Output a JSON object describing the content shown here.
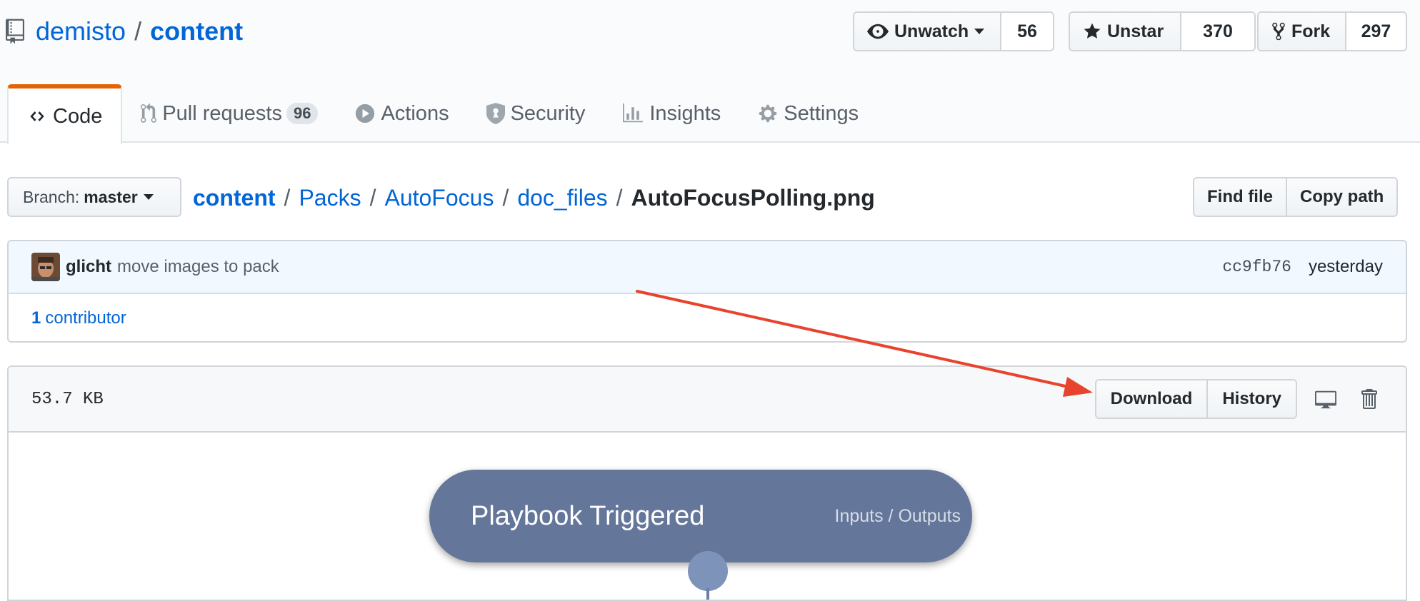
{
  "repo": {
    "owner": "demisto",
    "separator": "/",
    "name": "content"
  },
  "actions": {
    "watch": {
      "label": "Unwatch",
      "count": "56"
    },
    "star": {
      "label": "Unstar",
      "count": "370"
    },
    "fork": {
      "label": "Fork",
      "count": "297"
    }
  },
  "tabs": [
    {
      "label": "Code",
      "icon": "code-icon",
      "selected": true
    },
    {
      "label": "Pull requests",
      "icon": "git-pull-request-icon",
      "counter": "96"
    },
    {
      "label": "Actions",
      "icon": "play-icon"
    },
    {
      "label": "Security",
      "icon": "shield-icon"
    },
    {
      "label": "Insights",
      "icon": "graph-icon"
    },
    {
      "label": "Settings",
      "icon": "gear-icon"
    }
  ],
  "branch": {
    "prefix": "Branch:",
    "name": "master"
  },
  "breadcrumb": {
    "root": "content",
    "parts": [
      "Packs",
      "AutoFocus",
      "doc_files"
    ],
    "sep": "/",
    "file": "AutoFocusPolling.png"
  },
  "file_nav": {
    "find": "Find file",
    "copy": "Copy path"
  },
  "commit": {
    "author": "glicht",
    "message": "move images to pack",
    "sha": "cc9fb76",
    "date": "yesterday"
  },
  "contributors": {
    "count": "1",
    "label": "contributor"
  },
  "file": {
    "size": "53.7 KB",
    "download": "Download",
    "history": "History"
  },
  "preview": {
    "node_title": "Playbook Triggered",
    "node_io": "Inputs / Outputs"
  },
  "colors": {
    "link": "#0366d6",
    "selected_tab": "#e36209",
    "annotation_arrow": "#e8432d",
    "playbook_node": "#64769a"
  }
}
